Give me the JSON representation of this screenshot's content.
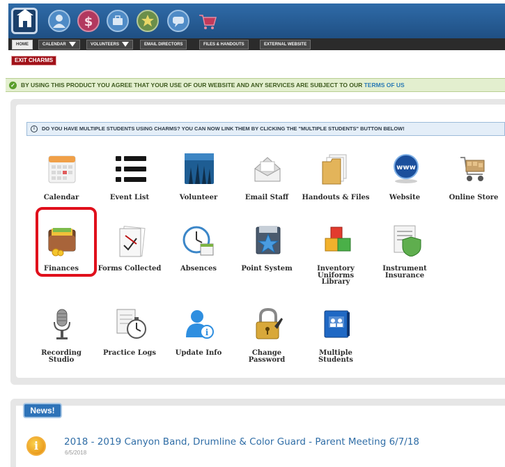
{
  "nav": {
    "tabs": [
      {
        "label": "HOME"
      },
      {
        "label": "CALENDAR"
      },
      {
        "label": "VOLUNTEERS"
      },
      {
        "label": "EMAIL DIRECTORS"
      },
      {
        "label": "FILES & HANDOUTS"
      },
      {
        "label": "EXTERNAL WEBSITE"
      }
    ],
    "exit_label": "EXIT CHARMS"
  },
  "terms": {
    "text": "BY USING THIS PRODUCT YOU AGREE THAT YOUR USE OF OUR WEBSITE AND ANY SERVICES ARE SUBJECT TO OUR",
    "link": "TERMS OF US"
  },
  "info": {
    "text": "DO YOU HAVE MULTIPLE STUDENTS USING CHARMS? YOU CAN NOW LINK THEM BY CLICKING THE \"MULTIPLE STUDENTS\" BUTTON BELOW!"
  },
  "tiles": [
    {
      "label": "Calendar"
    },
    {
      "label": "Event List"
    },
    {
      "label": "Volunteer"
    },
    {
      "label": "Email Staff"
    },
    {
      "label": "Handouts & Files"
    },
    {
      "label": "Website"
    },
    {
      "label": "Online Store"
    },
    {
      "label": "Finances"
    },
    {
      "label": "Forms Collected"
    },
    {
      "label": "Absences"
    },
    {
      "label": "Point System"
    },
    {
      "label": "Inventory\nUniforms\nLibrary"
    },
    {
      "label": "Instrument\nInsurance"
    },
    {
      "label": "Recording\nStudio"
    },
    {
      "label": "Practice Logs"
    },
    {
      "label": "Update Info"
    },
    {
      "label": "Change\nPassword"
    },
    {
      "label": "Multiple\nStudents"
    }
  ],
  "news": {
    "tab_label": "News!",
    "items": [
      {
        "title": "2018 - 2019 Canyon Band, Drumline & Color Guard - Parent Meeting 6/7/18",
        "date": "6/5/2018"
      }
    ]
  },
  "colors": {
    "topbar": "#2f6ba8",
    "exit": "#a11219",
    "highlight": "#e0101c",
    "terms_bg": "#e3efcf",
    "info_bg": "#e4eef8",
    "news_title": "#2f6da6"
  }
}
